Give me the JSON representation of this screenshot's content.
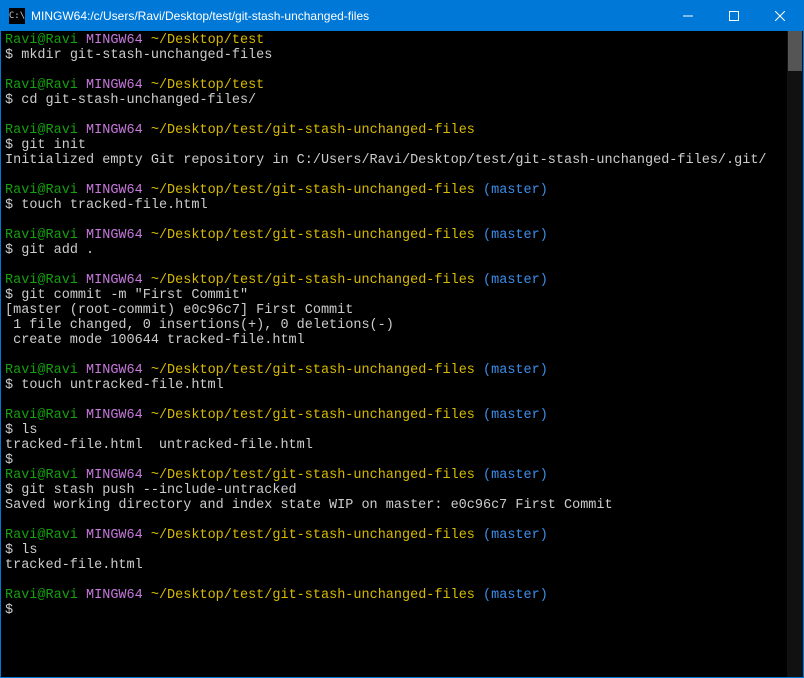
{
  "window": {
    "title": "MINGW64:/c/Users/Ravi/Desktop/test/git-stash-unchanged-files",
    "icon_label": "C:\\"
  },
  "prompt": {
    "user": "Ravi@Ravi",
    "shell": "MINGW64",
    "path_short": "~/Desktop/test",
    "path_full": "~/Desktop/test/git-stash-unchanged-files",
    "branch": "(master)",
    "dollar": "$"
  },
  "session": [
    {
      "path_key": "path_short",
      "branch": false,
      "cmd": "mkdir git-stash-unchanged-files",
      "out": []
    },
    {
      "path_key": "path_short",
      "branch": false,
      "cmd": "cd git-stash-unchanged-files/",
      "out": []
    },
    {
      "path_key": "path_full",
      "branch": false,
      "cmd": "git init",
      "out": [
        "Initialized empty Git repository in C:/Users/Ravi/Desktop/test/git-stash-unchanged-files/.git/"
      ]
    },
    {
      "path_key": "path_full",
      "branch": true,
      "cmd": "touch tracked-file.html",
      "out": []
    },
    {
      "path_key": "path_full",
      "branch": true,
      "cmd": "git add .",
      "out": []
    },
    {
      "path_key": "path_full",
      "branch": true,
      "cmd": "git commit -m \"First Commit\"",
      "out": [
        "[master (root-commit) e0c96c7] First Commit",
        " 1 file changed, 0 insertions(+), 0 deletions(-)",
        " create mode 100644 tracked-file.html"
      ]
    },
    {
      "path_key": "path_full",
      "branch": true,
      "cmd": "touch untracked-file.html",
      "out": []
    },
    {
      "path_key": "path_full",
      "branch": true,
      "cmd": "ls",
      "out": [
        "tracked-file.html  untracked-file.html"
      ],
      "trailing_dollar": true
    },
    {
      "path_key": "path_full",
      "branch": true,
      "cmd": "git stash push --include-untracked",
      "out": [
        "Saved working directory and index state WIP on master: e0c96c7 First Commit"
      ]
    },
    {
      "path_key": "path_full",
      "branch": true,
      "cmd": "ls",
      "out": [
        "tracked-file.html"
      ]
    },
    {
      "path_key": "path_full",
      "branch": true,
      "cmd": "",
      "out": []
    }
  ]
}
